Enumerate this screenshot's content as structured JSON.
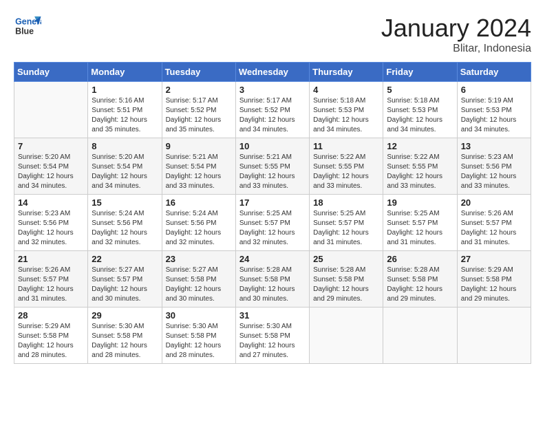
{
  "header": {
    "logo_line1": "General",
    "logo_line2": "Blue",
    "month": "January 2024",
    "location": "Blitar, Indonesia"
  },
  "weekdays": [
    "Sunday",
    "Monday",
    "Tuesday",
    "Wednesday",
    "Thursday",
    "Friday",
    "Saturday"
  ],
  "weeks": [
    [
      {
        "day": "",
        "info": ""
      },
      {
        "day": "1",
        "info": "Sunrise: 5:16 AM\nSunset: 5:51 PM\nDaylight: 12 hours\nand 35 minutes."
      },
      {
        "day": "2",
        "info": "Sunrise: 5:17 AM\nSunset: 5:52 PM\nDaylight: 12 hours\nand 35 minutes."
      },
      {
        "day": "3",
        "info": "Sunrise: 5:17 AM\nSunset: 5:52 PM\nDaylight: 12 hours\nand 34 minutes."
      },
      {
        "day": "4",
        "info": "Sunrise: 5:18 AM\nSunset: 5:53 PM\nDaylight: 12 hours\nand 34 minutes."
      },
      {
        "day": "5",
        "info": "Sunrise: 5:18 AM\nSunset: 5:53 PM\nDaylight: 12 hours\nand 34 minutes."
      },
      {
        "day": "6",
        "info": "Sunrise: 5:19 AM\nSunset: 5:53 PM\nDaylight: 12 hours\nand 34 minutes."
      }
    ],
    [
      {
        "day": "7",
        "info": "Sunrise: 5:20 AM\nSunset: 5:54 PM\nDaylight: 12 hours\nand 34 minutes."
      },
      {
        "day": "8",
        "info": "Sunrise: 5:20 AM\nSunset: 5:54 PM\nDaylight: 12 hours\nand 34 minutes."
      },
      {
        "day": "9",
        "info": "Sunrise: 5:21 AM\nSunset: 5:54 PM\nDaylight: 12 hours\nand 33 minutes."
      },
      {
        "day": "10",
        "info": "Sunrise: 5:21 AM\nSunset: 5:55 PM\nDaylight: 12 hours\nand 33 minutes."
      },
      {
        "day": "11",
        "info": "Sunrise: 5:22 AM\nSunset: 5:55 PM\nDaylight: 12 hours\nand 33 minutes."
      },
      {
        "day": "12",
        "info": "Sunrise: 5:22 AM\nSunset: 5:55 PM\nDaylight: 12 hours\nand 33 minutes."
      },
      {
        "day": "13",
        "info": "Sunrise: 5:23 AM\nSunset: 5:56 PM\nDaylight: 12 hours\nand 33 minutes."
      }
    ],
    [
      {
        "day": "14",
        "info": "Sunrise: 5:23 AM\nSunset: 5:56 PM\nDaylight: 12 hours\nand 32 minutes."
      },
      {
        "day": "15",
        "info": "Sunrise: 5:24 AM\nSunset: 5:56 PM\nDaylight: 12 hours\nand 32 minutes."
      },
      {
        "day": "16",
        "info": "Sunrise: 5:24 AM\nSunset: 5:56 PM\nDaylight: 12 hours\nand 32 minutes."
      },
      {
        "day": "17",
        "info": "Sunrise: 5:25 AM\nSunset: 5:57 PM\nDaylight: 12 hours\nand 32 minutes."
      },
      {
        "day": "18",
        "info": "Sunrise: 5:25 AM\nSunset: 5:57 PM\nDaylight: 12 hours\nand 31 minutes."
      },
      {
        "day": "19",
        "info": "Sunrise: 5:25 AM\nSunset: 5:57 PM\nDaylight: 12 hours\nand 31 minutes."
      },
      {
        "day": "20",
        "info": "Sunrise: 5:26 AM\nSunset: 5:57 PM\nDaylight: 12 hours\nand 31 minutes."
      }
    ],
    [
      {
        "day": "21",
        "info": "Sunrise: 5:26 AM\nSunset: 5:57 PM\nDaylight: 12 hours\nand 31 minutes."
      },
      {
        "day": "22",
        "info": "Sunrise: 5:27 AM\nSunset: 5:57 PM\nDaylight: 12 hours\nand 30 minutes."
      },
      {
        "day": "23",
        "info": "Sunrise: 5:27 AM\nSunset: 5:58 PM\nDaylight: 12 hours\nand 30 minutes."
      },
      {
        "day": "24",
        "info": "Sunrise: 5:28 AM\nSunset: 5:58 PM\nDaylight: 12 hours\nand 30 minutes."
      },
      {
        "day": "25",
        "info": "Sunrise: 5:28 AM\nSunset: 5:58 PM\nDaylight: 12 hours\nand 29 minutes."
      },
      {
        "day": "26",
        "info": "Sunrise: 5:28 AM\nSunset: 5:58 PM\nDaylight: 12 hours\nand 29 minutes."
      },
      {
        "day": "27",
        "info": "Sunrise: 5:29 AM\nSunset: 5:58 PM\nDaylight: 12 hours\nand 29 minutes."
      }
    ],
    [
      {
        "day": "28",
        "info": "Sunrise: 5:29 AM\nSunset: 5:58 PM\nDaylight: 12 hours\nand 28 minutes."
      },
      {
        "day": "29",
        "info": "Sunrise: 5:30 AM\nSunset: 5:58 PM\nDaylight: 12 hours\nand 28 minutes."
      },
      {
        "day": "30",
        "info": "Sunrise: 5:30 AM\nSunset: 5:58 PM\nDaylight: 12 hours\nand 28 minutes."
      },
      {
        "day": "31",
        "info": "Sunrise: 5:30 AM\nSunset: 5:58 PM\nDaylight: 12 hours\nand 27 minutes."
      },
      {
        "day": "",
        "info": ""
      },
      {
        "day": "",
        "info": ""
      },
      {
        "day": "",
        "info": ""
      }
    ]
  ]
}
